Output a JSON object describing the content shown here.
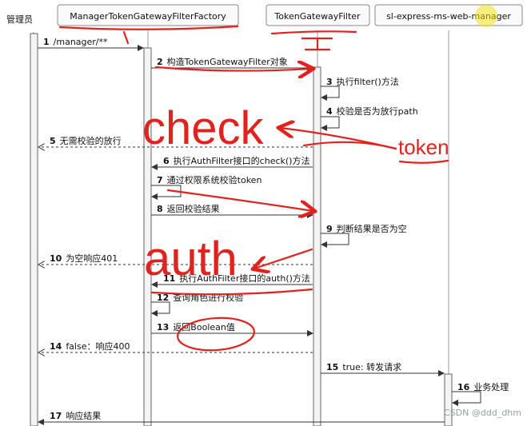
{
  "participants": [
    {
      "name": "管理员"
    },
    {
      "name": "ManagerTokenGatewayFilterFactory"
    },
    {
      "name": "TokenGatewayFilter"
    },
    {
      "name": "sl-express-ms-web-manager"
    }
  ],
  "messages": [
    {
      "num": "1",
      "text": "/manager/**"
    },
    {
      "num": "2",
      "text": "构造TokenGatewayFilter对象"
    },
    {
      "num": "3",
      "text": "执行filter()方法"
    },
    {
      "num": "4",
      "text": "校验是否为放行path"
    },
    {
      "num": "5",
      "text": "无需校验的放行"
    },
    {
      "num": "6",
      "text": "执行AuthFilter接口的check()方法"
    },
    {
      "num": "7",
      "text": "通过权限系统校验token"
    },
    {
      "num": "8",
      "text": "返回校验结果"
    },
    {
      "num": "9",
      "text": "判断结果是否为空"
    },
    {
      "num": "10",
      "text": "为空响应401"
    },
    {
      "num": "11",
      "text": "执行AuthFilter接口的auth()方法"
    },
    {
      "num": "12",
      "text": "查询角色进行校验"
    },
    {
      "num": "13",
      "text": "返回Boolean值"
    },
    {
      "num": "14",
      "text": "false：响应400"
    },
    {
      "num": "15",
      "text": "true: 转发请求"
    },
    {
      "num": "16",
      "text": "业务处理"
    },
    {
      "num": "17",
      "text": "响应结果"
    }
  ],
  "annotations": {
    "check": "check",
    "token": "token",
    "auth": "auth",
    "annotation_color": "#e0231f"
  },
  "watermark": "CSDN @ddd_dhm"
}
